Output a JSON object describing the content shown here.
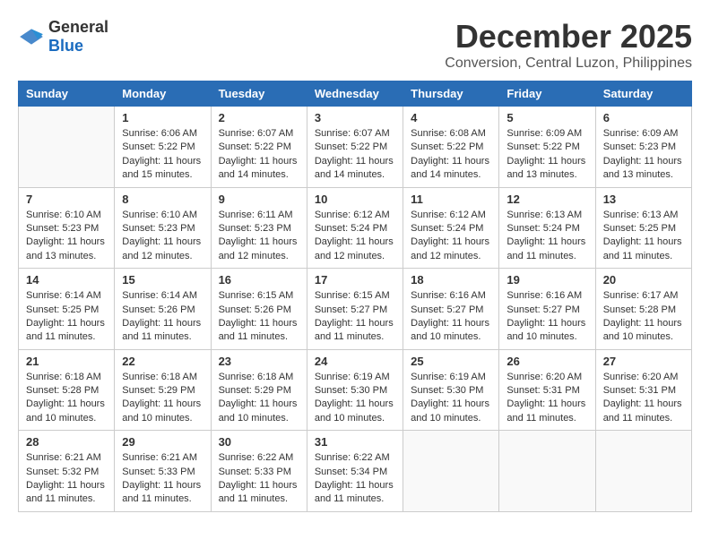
{
  "header": {
    "logo_general": "General",
    "logo_blue": "Blue",
    "month_title": "December 2025",
    "location": "Conversion, Central Luzon, Philippines"
  },
  "days_of_week": [
    "Sunday",
    "Monday",
    "Tuesday",
    "Wednesday",
    "Thursday",
    "Friday",
    "Saturday"
  ],
  "weeks": [
    [
      {
        "day": "",
        "sunrise": "",
        "sunset": "",
        "daylight": ""
      },
      {
        "day": "1",
        "sunrise": "Sunrise: 6:06 AM",
        "sunset": "Sunset: 5:22 PM",
        "daylight": "Daylight: 11 hours and 15 minutes."
      },
      {
        "day": "2",
        "sunrise": "Sunrise: 6:07 AM",
        "sunset": "Sunset: 5:22 PM",
        "daylight": "Daylight: 11 hours and 14 minutes."
      },
      {
        "day": "3",
        "sunrise": "Sunrise: 6:07 AM",
        "sunset": "Sunset: 5:22 PM",
        "daylight": "Daylight: 11 hours and 14 minutes."
      },
      {
        "day": "4",
        "sunrise": "Sunrise: 6:08 AM",
        "sunset": "Sunset: 5:22 PM",
        "daylight": "Daylight: 11 hours and 14 minutes."
      },
      {
        "day": "5",
        "sunrise": "Sunrise: 6:09 AM",
        "sunset": "Sunset: 5:22 PM",
        "daylight": "Daylight: 11 hours and 13 minutes."
      },
      {
        "day": "6",
        "sunrise": "Sunrise: 6:09 AM",
        "sunset": "Sunset: 5:23 PM",
        "daylight": "Daylight: 11 hours and 13 minutes."
      }
    ],
    [
      {
        "day": "7",
        "sunrise": "Sunrise: 6:10 AM",
        "sunset": "Sunset: 5:23 PM",
        "daylight": "Daylight: 11 hours and 13 minutes."
      },
      {
        "day": "8",
        "sunrise": "Sunrise: 6:10 AM",
        "sunset": "Sunset: 5:23 PM",
        "daylight": "Daylight: 11 hours and 12 minutes."
      },
      {
        "day": "9",
        "sunrise": "Sunrise: 6:11 AM",
        "sunset": "Sunset: 5:23 PM",
        "daylight": "Daylight: 11 hours and 12 minutes."
      },
      {
        "day": "10",
        "sunrise": "Sunrise: 6:12 AM",
        "sunset": "Sunset: 5:24 PM",
        "daylight": "Daylight: 11 hours and 12 minutes."
      },
      {
        "day": "11",
        "sunrise": "Sunrise: 6:12 AM",
        "sunset": "Sunset: 5:24 PM",
        "daylight": "Daylight: 11 hours and 12 minutes."
      },
      {
        "day": "12",
        "sunrise": "Sunrise: 6:13 AM",
        "sunset": "Sunset: 5:24 PM",
        "daylight": "Daylight: 11 hours and 11 minutes."
      },
      {
        "day": "13",
        "sunrise": "Sunrise: 6:13 AM",
        "sunset": "Sunset: 5:25 PM",
        "daylight": "Daylight: 11 hours and 11 minutes."
      }
    ],
    [
      {
        "day": "14",
        "sunrise": "Sunrise: 6:14 AM",
        "sunset": "Sunset: 5:25 PM",
        "daylight": "Daylight: 11 hours and 11 minutes."
      },
      {
        "day": "15",
        "sunrise": "Sunrise: 6:14 AM",
        "sunset": "Sunset: 5:26 PM",
        "daylight": "Daylight: 11 hours and 11 minutes."
      },
      {
        "day": "16",
        "sunrise": "Sunrise: 6:15 AM",
        "sunset": "Sunset: 5:26 PM",
        "daylight": "Daylight: 11 hours and 11 minutes."
      },
      {
        "day": "17",
        "sunrise": "Sunrise: 6:15 AM",
        "sunset": "Sunset: 5:27 PM",
        "daylight": "Daylight: 11 hours and 11 minutes."
      },
      {
        "day": "18",
        "sunrise": "Sunrise: 6:16 AM",
        "sunset": "Sunset: 5:27 PM",
        "daylight": "Daylight: 11 hours and 10 minutes."
      },
      {
        "day": "19",
        "sunrise": "Sunrise: 6:16 AM",
        "sunset": "Sunset: 5:27 PM",
        "daylight": "Daylight: 11 hours and 10 minutes."
      },
      {
        "day": "20",
        "sunrise": "Sunrise: 6:17 AM",
        "sunset": "Sunset: 5:28 PM",
        "daylight": "Daylight: 11 hours and 10 minutes."
      }
    ],
    [
      {
        "day": "21",
        "sunrise": "Sunrise: 6:18 AM",
        "sunset": "Sunset: 5:28 PM",
        "daylight": "Daylight: 11 hours and 10 minutes."
      },
      {
        "day": "22",
        "sunrise": "Sunrise: 6:18 AM",
        "sunset": "Sunset: 5:29 PM",
        "daylight": "Daylight: 11 hours and 10 minutes."
      },
      {
        "day": "23",
        "sunrise": "Sunrise: 6:18 AM",
        "sunset": "Sunset: 5:29 PM",
        "daylight": "Daylight: 11 hours and 10 minutes."
      },
      {
        "day": "24",
        "sunrise": "Sunrise: 6:19 AM",
        "sunset": "Sunset: 5:30 PM",
        "daylight": "Daylight: 11 hours and 10 minutes."
      },
      {
        "day": "25",
        "sunrise": "Sunrise: 6:19 AM",
        "sunset": "Sunset: 5:30 PM",
        "daylight": "Daylight: 11 hours and 10 minutes."
      },
      {
        "day": "26",
        "sunrise": "Sunrise: 6:20 AM",
        "sunset": "Sunset: 5:31 PM",
        "daylight": "Daylight: 11 hours and 11 minutes."
      },
      {
        "day": "27",
        "sunrise": "Sunrise: 6:20 AM",
        "sunset": "Sunset: 5:31 PM",
        "daylight": "Daylight: 11 hours and 11 minutes."
      }
    ],
    [
      {
        "day": "28",
        "sunrise": "Sunrise: 6:21 AM",
        "sunset": "Sunset: 5:32 PM",
        "daylight": "Daylight: 11 hours and 11 minutes."
      },
      {
        "day": "29",
        "sunrise": "Sunrise: 6:21 AM",
        "sunset": "Sunset: 5:33 PM",
        "daylight": "Daylight: 11 hours and 11 minutes."
      },
      {
        "day": "30",
        "sunrise": "Sunrise: 6:22 AM",
        "sunset": "Sunset: 5:33 PM",
        "daylight": "Daylight: 11 hours and 11 minutes."
      },
      {
        "day": "31",
        "sunrise": "Sunrise: 6:22 AM",
        "sunset": "Sunset: 5:34 PM",
        "daylight": "Daylight: 11 hours and 11 minutes."
      },
      {
        "day": "",
        "sunrise": "",
        "sunset": "",
        "daylight": ""
      },
      {
        "day": "",
        "sunrise": "",
        "sunset": "",
        "daylight": ""
      },
      {
        "day": "",
        "sunrise": "",
        "sunset": "",
        "daylight": ""
      }
    ]
  ]
}
